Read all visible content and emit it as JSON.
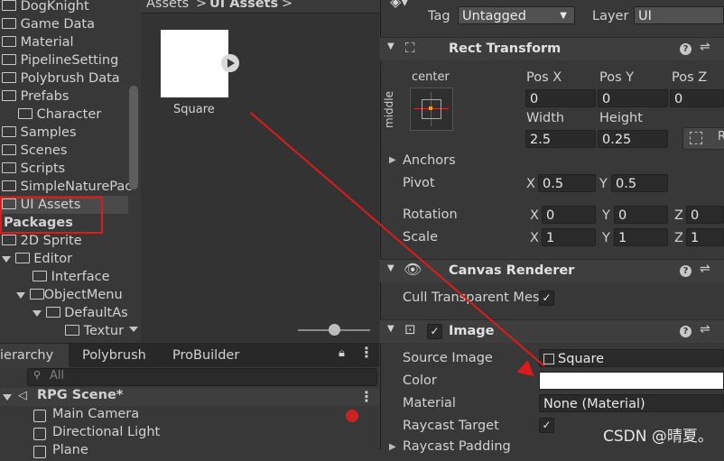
{
  "project_tree": {
    "items": [
      {
        "label": "DogKnight"
      },
      {
        "label": "Game Data"
      },
      {
        "label": "Material"
      },
      {
        "label": "PipelineSetting"
      },
      {
        "label": "Polybrush Data"
      },
      {
        "label": "Prefabs"
      },
      {
        "label": "Character"
      },
      {
        "label": "Samples"
      },
      {
        "label": "Scenes"
      },
      {
        "label": "Scripts"
      },
      {
        "label": "SimpleNaturePac"
      },
      {
        "label": "UI Assets"
      },
      {
        "label": "Packages"
      },
      {
        "label": "2D Sprite"
      },
      {
        "label": "Editor"
      },
      {
        "label": "Interface"
      },
      {
        "label": "ObjectMenu"
      },
      {
        "label": "DefaultAs"
      },
      {
        "label": "Textur"
      }
    ]
  },
  "assets_panel": {
    "breadcrumb": [
      "Assets",
      "UI Assets"
    ],
    "items": [
      {
        "label": "Square"
      }
    ]
  },
  "hierarchy_panel": {
    "tabs": [
      "ierarchy",
      "Polybrush",
      "ProBuilder"
    ],
    "search_placeholder": "All",
    "scene_name": "RPG Scene*",
    "objects": [
      "Main Camera",
      "Directional Light",
      "Plane"
    ]
  },
  "inspector": {
    "tag_label": "Tag",
    "tag_value": "Untagged",
    "layer_label": "Layer",
    "layer_value": "UI",
    "rect_transform": {
      "title": "Rect Transform",
      "anchor_preset_h": "center",
      "anchor_preset_v": "middle",
      "pos_x_label": "Pos X",
      "pos_y_label": "Pos Y",
      "pos_z_label": "Pos Z",
      "pos_x": "0",
      "pos_y": "0",
      "pos_z": "0",
      "width_label": "Width",
      "height_label": "Height",
      "width": "2.5",
      "height": "0.25",
      "anchors_label": "Anchors",
      "pivot_label": "Pivot",
      "pivot_x": "0.5",
      "pivot_y": "0.5",
      "rotation_label": "Rotation",
      "rotation_x": "0",
      "rotation_y": "0",
      "rotation_z": "0",
      "scale_label": "Scale",
      "scale_x": "1",
      "scale_y": "1",
      "scale_z": "1",
      "axis_x": "X",
      "axis_y": "Y",
      "axis_z": "Z"
    },
    "canvas_renderer": {
      "title": "Canvas Renderer",
      "cull_label": "Cull Transparent Mes"
    },
    "image": {
      "title": "Image",
      "source_image_label": "Source Image",
      "source_image_value": "Square",
      "color_label": "Color",
      "color_value": "#ffffff",
      "material_label": "Material",
      "material_value": "None (Material)",
      "raycast_target_label": "Raycast Target",
      "raycast_padding_label": "Raycast Padding"
    }
  },
  "watermark": "CSDN @晴夏。",
  "colors": {
    "panel_bg": "#383838",
    "field_bg": "#2a2a2a",
    "annotation_red": "#e01a1a",
    "text": "#d2d2d2"
  }
}
